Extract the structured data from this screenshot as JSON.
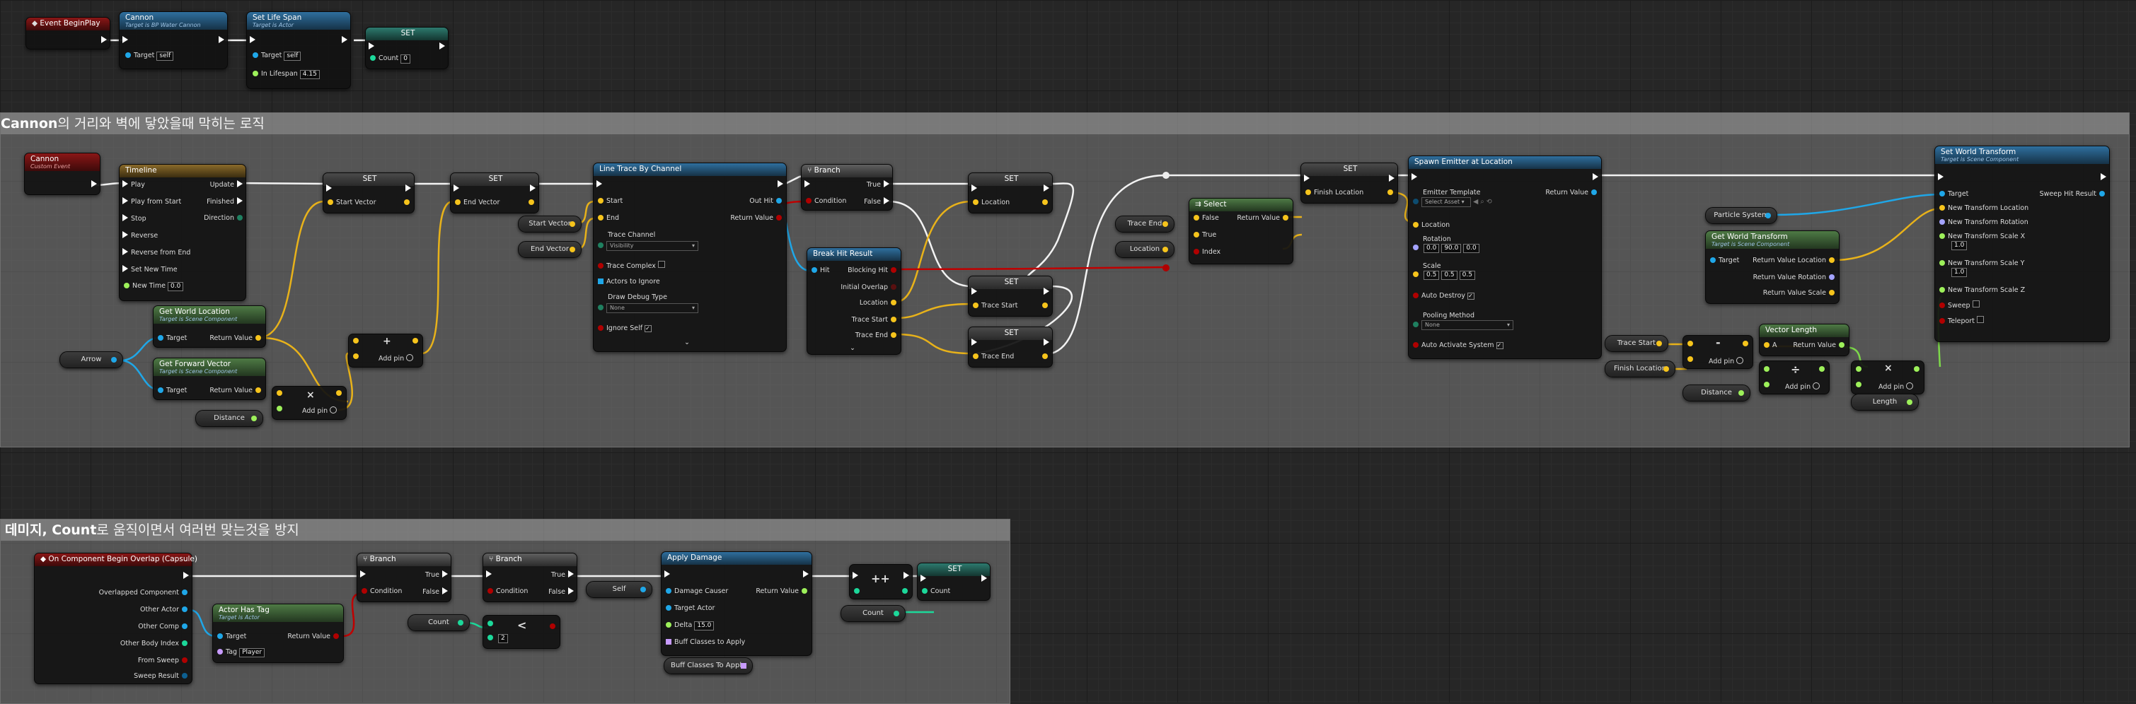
{
  "comments": [
    {
      "title_bold": "Cannon",
      "title_rest": "의 거리와 벽에 닿았을때 막히는 로직"
    },
    {
      "title_bold_pre": "데미지, ",
      "title_bold": "Count",
      "title_rest": "로 움직이면서 여러번 맞는것을 방지"
    }
  ],
  "event_beginplay": {
    "title": "Event BeginPlay"
  },
  "cannon_call": {
    "title": "Cannon",
    "subtitle": "Target is BP Water Cannon",
    "target_label": "Target",
    "target_value": "self"
  },
  "set_lifespan": {
    "title": "Set Life Span",
    "subtitle": "Target is Actor",
    "target_label": "Target",
    "target_value": "self",
    "lifespan_label": "In Lifespan",
    "lifespan_value": "4.15"
  },
  "set_count_top": {
    "title": "SET",
    "count_label": "Count",
    "count_value": "0"
  },
  "cannon_event": {
    "title": "Cannon",
    "subtitle": "Custom Event"
  },
  "timeline": {
    "title": "Timeline",
    "inputs": [
      "Play",
      "Play from Start",
      "Stop",
      "Reverse",
      "Reverse from End",
      "Set New Time",
      "New Time"
    ],
    "new_time_value": "0.0",
    "outputs": [
      "Update",
      "Finished",
      "Direction"
    ]
  },
  "set_start_vector": {
    "title": "SET",
    "label": "Start Vector"
  },
  "set_end_vector": {
    "title": "SET",
    "label": "End Vector"
  },
  "get_world_location": {
    "title": "Get World Location",
    "subtitle": "Target is Scene Component",
    "target": "Target",
    "ret": "Return Value"
  },
  "get_forward_vector": {
    "title": "Get Forward Vector",
    "subtitle": "Target is Scene Component",
    "target": "Target",
    "ret": "Return Value"
  },
  "arrow_var": "Arrow",
  "distance_var": "Distance",
  "add_pin": "Add pin",
  "start_vector_var": "Start Vector",
  "end_vector_var": "End Vector",
  "line_trace": {
    "title": "Line Trace By Channel",
    "start": "Start",
    "end": "End",
    "trace_channel_label": "Trace Channel",
    "trace_channel_value": "Visibility",
    "trace_complex": "Trace Complex",
    "actors_to_ignore": "Actors to Ignore",
    "draw_debug_label": "Draw Debug Type",
    "draw_debug_value": "None",
    "ignore_self": "Ignore Self",
    "out_hit": "Out Hit",
    "return_value": "Return Value"
  },
  "branch_top": {
    "title": "Branch",
    "condition": "Condition",
    "true": "True",
    "false": "False"
  },
  "break_hit": {
    "title": "Break Hit Result",
    "hit": "Hit",
    "outputs": [
      "Blocking Hit",
      "Initial Overlap",
      "Location",
      "Trace Start",
      "Trace End"
    ]
  },
  "set_location": {
    "title": "SET",
    "label": "Location"
  },
  "set_trace_start": {
    "title": "SET",
    "label": "Trace Start"
  },
  "set_trace_end": {
    "title": "SET",
    "label": "Trace End"
  },
  "trace_end_var": "Trace End",
  "location_var": "Location",
  "select_node": {
    "title": "Select",
    "false": "False",
    "true": "True",
    "index": "Index",
    "ret": "Return Value"
  },
  "set_finish_location": {
    "title": "SET",
    "label": "Finish Location"
  },
  "spawn_emitter": {
    "title": "Spawn Emitter at Location",
    "emitter_template": "Emitter Template",
    "emitter_value": "Select Asset",
    "location": "Location",
    "rotation": "Rotation",
    "rotation_values": [
      "0.0",
      "90.0",
      "0.0"
    ],
    "scale": "Scale",
    "scale_values": [
      "0.5",
      "0.5",
      "0.5"
    ],
    "auto_destroy": "Auto Destroy",
    "pooling_method": "Pooling Method",
    "pooling_value": "None",
    "auto_activate": "Auto Activate System",
    "ret": "Return Value"
  },
  "particle_system_var": "Particle System",
  "get_world_transform": {
    "title": "Get World Transform",
    "subtitle": "Target is Scene Component",
    "target": "Target",
    "outputs": [
      "Return Value Location",
      "Return Value Rotation",
      "Return Value Scale"
    ]
  },
  "set_world_transform": {
    "title": "Set World Transform",
    "subtitle": "Target is Scene Component",
    "inputs": [
      "Target",
      "New Transform Location",
      "New Transform Rotation",
      "New Transform Scale X",
      "New Transform Scale Y",
      "New Transform Scale Z",
      "Sweep",
      "Teleport"
    ],
    "scale_x": "1.0",
    "scale_y": "1.0",
    "sweep_hit": "Sweep Hit Result"
  },
  "trace_start_var": "Trace Start",
  "finish_location_var": "Finish Location",
  "vector_length": {
    "title": "Vector Length",
    "a": "A",
    "ret": "Return Value"
  },
  "length_var": "Length",
  "overlap_event": {
    "title": "On Component Begin Overlap (Capsule)",
    "outputs": [
      "Overlapped Component",
      "Other Actor",
      "Other Comp",
      "Other Body Index",
      "From Sweep",
      "Sweep Result"
    ]
  },
  "actor_has_tag": {
    "title": "Actor Has Tag",
    "subtitle": "Target is Actor",
    "target": "Target",
    "tag": "Tag",
    "tag_value": "Player",
    "ret": "Return Value"
  },
  "branch_b1": {
    "title": "Branch",
    "condition": "Condition",
    "true": "True",
    "false": "False"
  },
  "branch_b2": {
    "title": "Branch",
    "condition": "Condition",
    "true": "True",
    "false": "False"
  },
  "count_var": "Count",
  "less_value": "2",
  "self_var": "Self",
  "apply_damage": {
    "title": "Apply Damage",
    "inputs": [
      "Damage Causer",
      "Target Actor",
      "Delta",
      "Buff Classes to Apply"
    ],
    "delta_value": "15.0",
    "ret": "Return Value"
  },
  "buff_var": "Buff Classes To Apply",
  "increment": "++",
  "set_count_bottom": {
    "title": "SET",
    "label": "Count"
  }
}
